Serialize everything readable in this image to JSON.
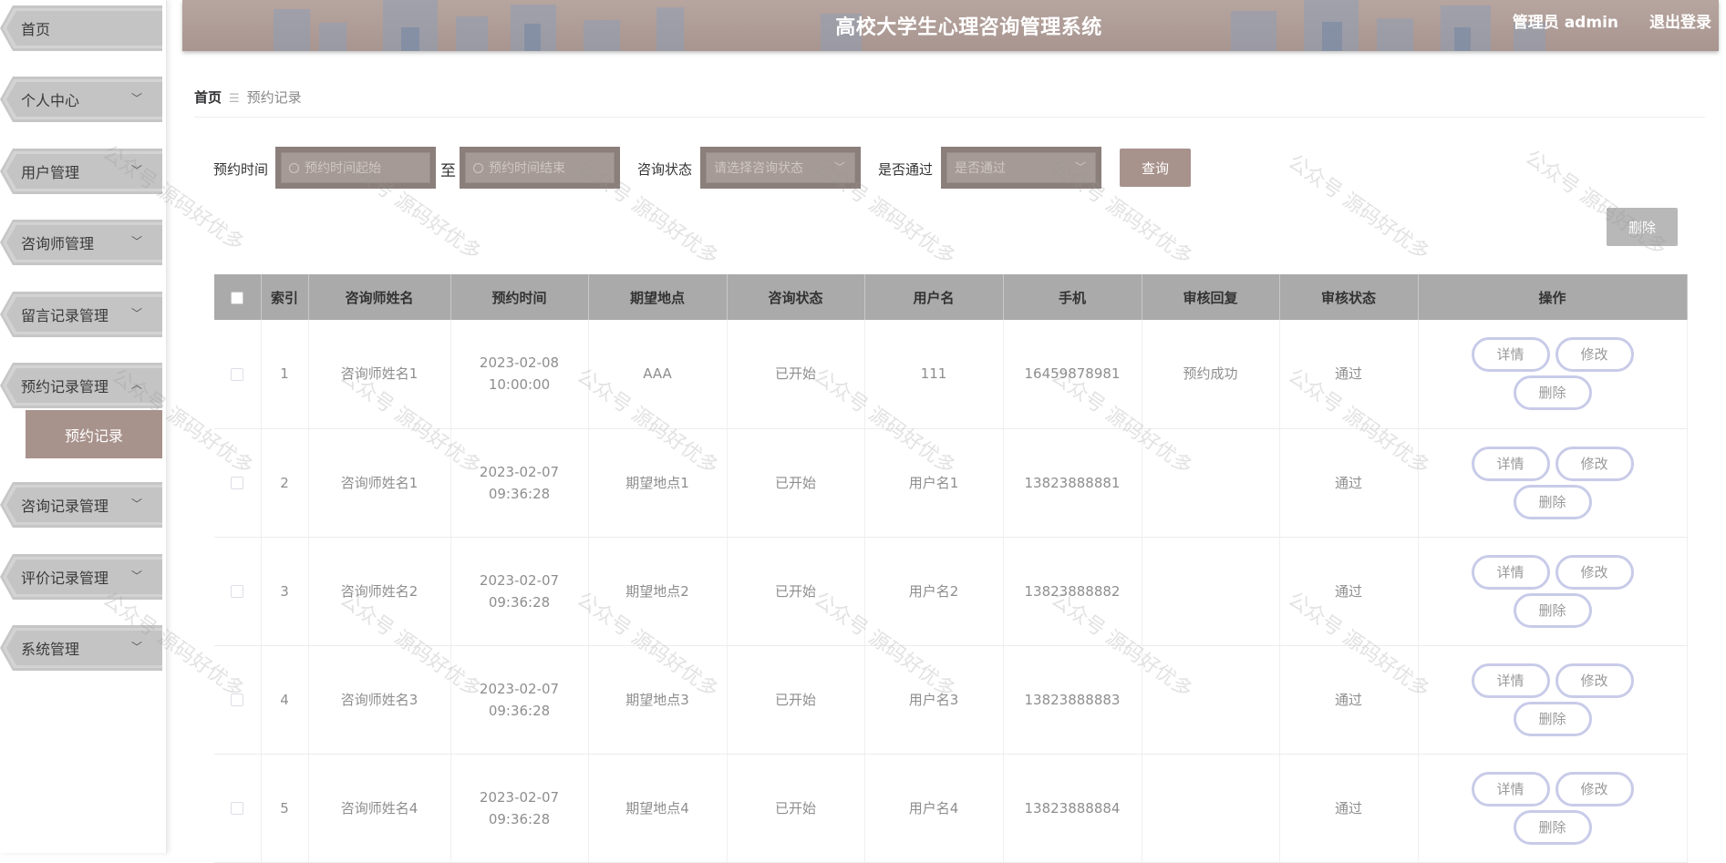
{
  "header": {
    "title": "高校大学生心理咨询管理系统",
    "user": "管理员 admin",
    "logout": "退出登录"
  },
  "sidebar": {
    "items": [
      {
        "label": "首页",
        "expandable": false
      },
      {
        "label": "个人中心",
        "expandable": true
      },
      {
        "label": "用户管理",
        "expandable": true
      },
      {
        "label": "咨询师管理",
        "expandable": true
      },
      {
        "label": "留言记录管理",
        "expandable": true
      },
      {
        "label": "预约记录管理",
        "expandable": true,
        "expanded": true
      },
      {
        "label": "咨询记录管理",
        "expandable": true
      },
      {
        "label": "评价记录管理",
        "expandable": true
      },
      {
        "label": "系统管理",
        "expandable": true
      }
    ],
    "submenu": {
      "label": "预约记录"
    },
    "chevron_down": "﹀",
    "chevron_up": "︿"
  },
  "breadcrumb": {
    "home": "首页",
    "separator": "☰",
    "current": "预约记录"
  },
  "search": {
    "time_label": "预约时间",
    "time_start_placeholder": "预约时间起始",
    "to_label": "至",
    "time_end_placeholder": "预约时间结束",
    "status_label": "咨询状态",
    "status_placeholder": "请选择咨询状态",
    "pass_label": "是否通过",
    "pass_placeholder": "是否通过",
    "query_button": "查询"
  },
  "toolbar": {
    "delete_button": "删除"
  },
  "table": {
    "columns": [
      "索引",
      "咨询师姓名",
      "预约时间",
      "期望地点",
      "咨询状态",
      "用户名",
      "手机",
      "审核回复",
      "审核状态",
      "操作"
    ],
    "rows": [
      {
        "index": "1",
        "counselor": "咨询师姓名1",
        "time": "2023-02-08 10:00:00",
        "place": "AAA",
        "status": "已开始",
        "username": "111",
        "phone": "16459878981",
        "reply": "预约成功",
        "review": "通过"
      },
      {
        "index": "2",
        "counselor": "咨询师姓名1",
        "time": "2023-02-07 09:36:28",
        "place": "期望地点1",
        "status": "已开始",
        "username": "用户名1",
        "phone": "13823888881",
        "reply": "",
        "review": "通过"
      },
      {
        "index": "3",
        "counselor": "咨询师姓名2",
        "time": "2023-02-07 09:36:28",
        "place": "期望地点2",
        "status": "已开始",
        "username": "用户名2",
        "phone": "13823888882",
        "reply": "",
        "review": "通过"
      },
      {
        "index": "4",
        "counselor": "咨询师姓名3",
        "time": "2023-02-07 09:36:28",
        "place": "期望地点3",
        "status": "已开始",
        "username": "用户名3",
        "phone": "13823888883",
        "reply": "",
        "review": "通过"
      },
      {
        "index": "5",
        "counselor": "咨询师姓名4",
        "time": "2023-02-07 09:36:28",
        "place": "期望地点4",
        "status": "已开始",
        "username": "用户名4",
        "phone": "13823888884",
        "reply": "",
        "review": "通过"
      }
    ],
    "actions": {
      "detail": "详情",
      "edit": "修改",
      "delete": "删除"
    }
  },
  "watermark": "公众号 源码好优多",
  "colors": {
    "accent": "#a8928c",
    "menu_bg": "#c6c6c6",
    "table_header": "#aaaaaa",
    "button_border": "#c8cbe8"
  }
}
